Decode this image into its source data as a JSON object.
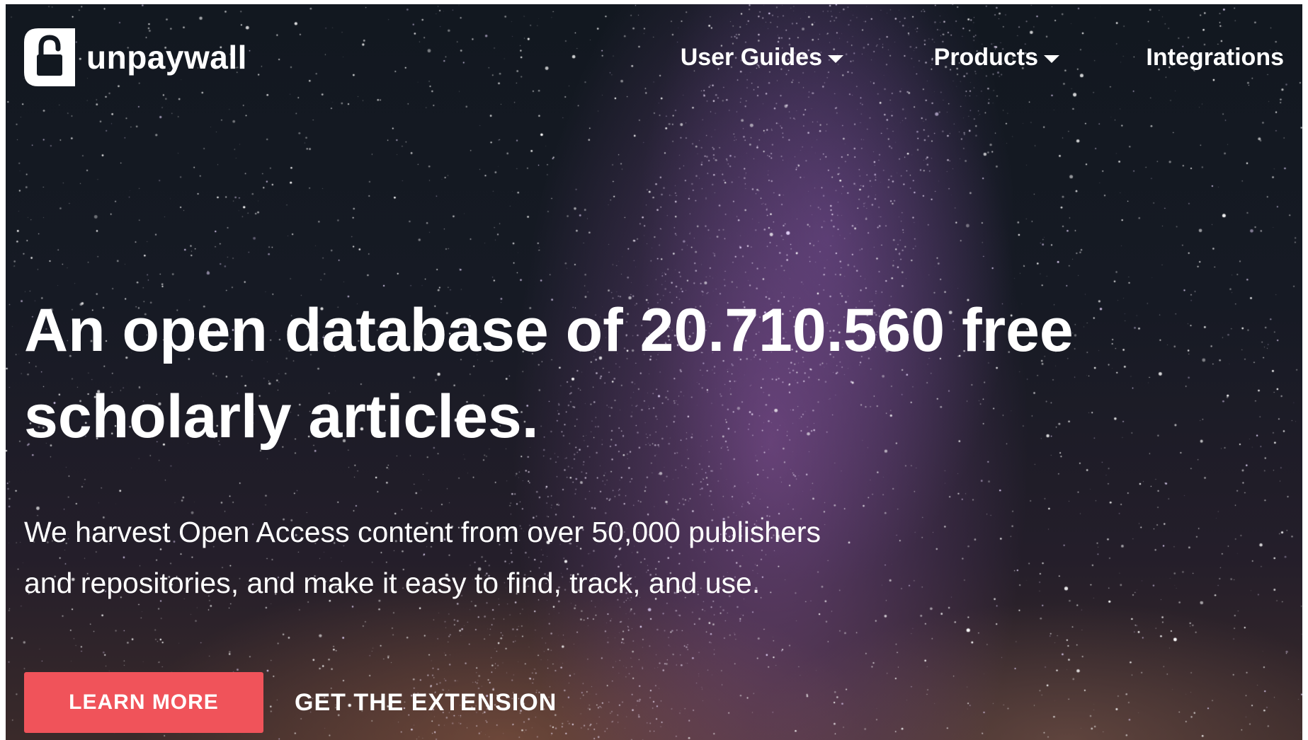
{
  "brand": {
    "name": "unpaywall",
    "logo_icon": "open-lock-icon"
  },
  "nav": {
    "items": [
      {
        "label": "User Guides",
        "has_dropdown": true
      },
      {
        "label": "Products",
        "has_dropdown": true
      },
      {
        "label": "Integrations",
        "has_dropdown": false
      }
    ]
  },
  "hero": {
    "headline_line1": "An open database of 20.710.560 free",
    "headline_line2": "scholarly articles.",
    "subhead_line1": "We harvest Open Access content from over 50,000 publishers",
    "subhead_line2": "and repositories, and make it easy to find, track, and use."
  },
  "actions": {
    "primary_label": "LEARN MORE",
    "secondary_label": "GET THE EXTENSION"
  },
  "colors": {
    "accent": "#f0535a",
    "text": "#ffffff",
    "sky": "#121820",
    "milky_way": "#965aaa"
  }
}
